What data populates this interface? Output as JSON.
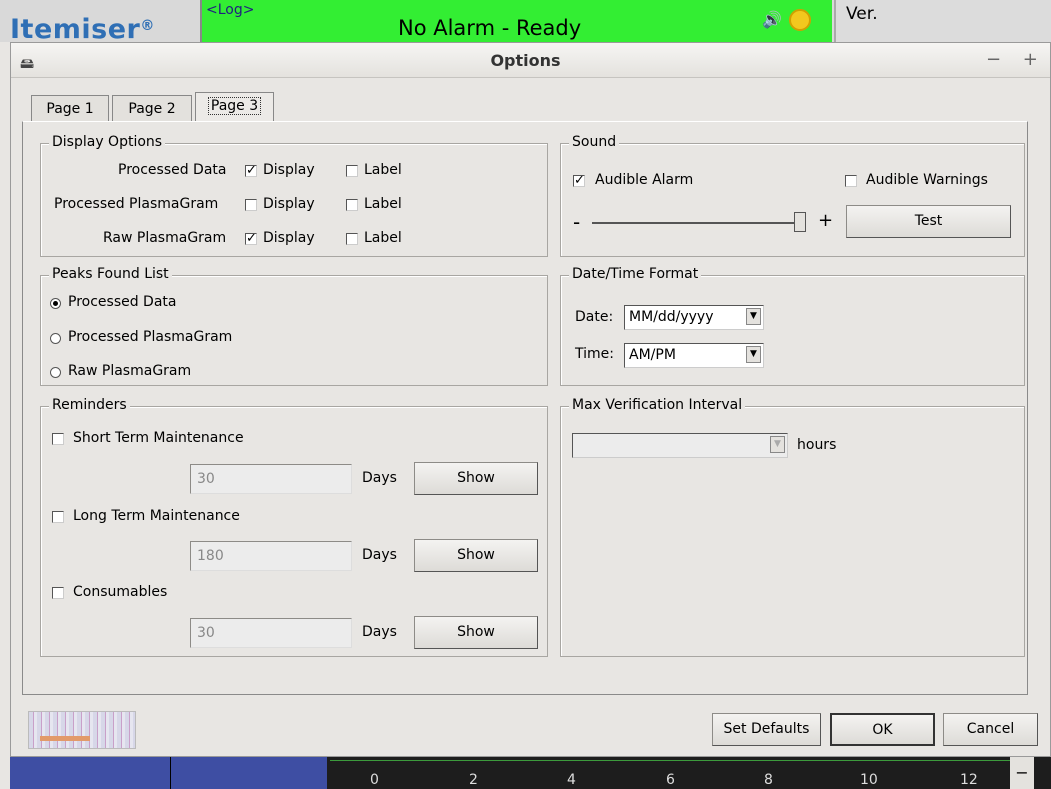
{
  "statusbar": {
    "logo": "Itemiser",
    "logo_mark": "®",
    "log_link": "<Log>",
    "alarm_status": "No Alarm - Ready",
    "speaker_icon": "🔊",
    "version_label": "Ver."
  },
  "dialog": {
    "title": "Options",
    "controls": "− + ×"
  },
  "tabs": [
    "Page 1",
    "Page 2",
    "Page 3"
  ],
  "display_options": {
    "title": "Display Options",
    "rows": [
      {
        "name": "Processed Data",
        "display": "Display",
        "display_checked": true,
        "label": "Label",
        "label_checked": false
      },
      {
        "name": "Processed PlasmaGram",
        "display": "Display",
        "display_checked": false,
        "label": "Label",
        "label_checked": false
      },
      {
        "name": "Raw PlasmaGram",
        "display": "Display",
        "display_checked": true,
        "label": "Label",
        "label_checked": false
      }
    ]
  },
  "sound": {
    "title": "Sound",
    "audible_alarm": "Audible Alarm",
    "audible_alarm_checked": true,
    "audible_warnings": "Audible Warnings",
    "audible_warnings_checked": false,
    "minus": "-",
    "plus": "+",
    "volume_level": 0.97,
    "test_button": "Test"
  },
  "peaks": {
    "title": "Peaks Found List",
    "options": [
      "Processed Data",
      "Processed PlasmaGram",
      "Raw PlasmaGram"
    ],
    "selected": 0
  },
  "datetime": {
    "title": "Date/Time Format",
    "date_label": "Date:",
    "date_value": "MM/dd/yyyy",
    "time_label": "Time:",
    "time_value": "AM/PM"
  },
  "reminders": {
    "title": "Reminders",
    "items": [
      {
        "name": "Short Term Maintenance",
        "checked": false,
        "value": "30",
        "unit": "Days",
        "button": "Show"
      },
      {
        "name": "Long Term Maintenance",
        "checked": false,
        "value": "180",
        "unit": "Days",
        "button": "Show"
      },
      {
        "name": "Consumables",
        "checked": false,
        "value": "30",
        "unit": "Days",
        "button": "Show"
      }
    ]
  },
  "verification": {
    "title": "Max Verification Interval",
    "value": "",
    "unit": "hours"
  },
  "footer": {
    "set_defaults": "Set Defaults",
    "ok": "OK",
    "cancel": "Cancel"
  },
  "plot_axis": {
    "ticks": [
      "0",
      "2",
      "4",
      "6",
      "8",
      "10",
      "12"
    ],
    "minus": "−"
  }
}
